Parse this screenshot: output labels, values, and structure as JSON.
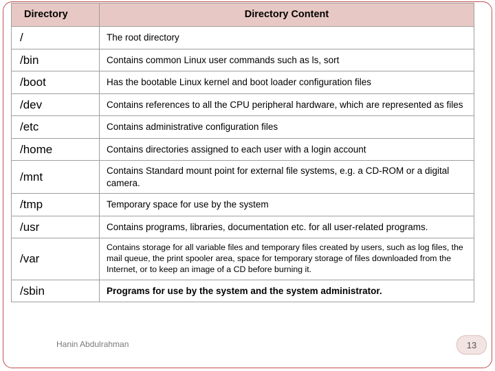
{
  "slide": {
    "author_footer": "Hanin Abdulrahman",
    "page_number": "13"
  },
  "table": {
    "headers": [
      "Directory",
      "Directory Content"
    ],
    "rows": [
      {
        "dir": "/",
        "desc": "The root directory",
        "style": "normal"
      },
      {
        "dir": "/bin",
        "desc": "Contains common Linux user commands  such as ls, sort",
        "style": "normal"
      },
      {
        "dir": "/boot",
        "desc": "Has the bootable Linux kernel and boot loader configuration files",
        "style": "normal"
      },
      {
        "dir": "/dev",
        "desc": "Contains references to all the CPU peripheral hardware, which are represented as files",
        "style": "normal"
      },
      {
        "dir": "/etc",
        "desc": "Contains administrative configuration files",
        "style": "normal"
      },
      {
        "dir": "/home",
        "desc": "Contains directories assigned to each user with a login account",
        "style": "normal"
      },
      {
        "dir": "/mnt",
        "desc": "Contains Standard mount point for external file systems, e.g. a CD-ROM or a digital camera.",
        "style": "normal"
      },
      {
        "dir": "/tmp",
        "desc": "Temporary space for use by the system",
        "style": "normal"
      },
      {
        "dir": "/usr",
        "desc": "Contains programs, libraries, documentation etc. for all user-related programs.",
        "style": "normal"
      },
      {
        "dir": "/var",
        "desc": "Contains storage for all variable files and temporary files created by users, such as log files, the mail queue, the print spooler area, space for temporary storage of files downloaded from the Internet, or to keep an image of a CD before burning it.",
        "style": "small"
      },
      {
        "dir": "/sbin",
        "desc": "Programs for use by the system and the system administrator.",
        "style": "bold-note"
      }
    ]
  }
}
